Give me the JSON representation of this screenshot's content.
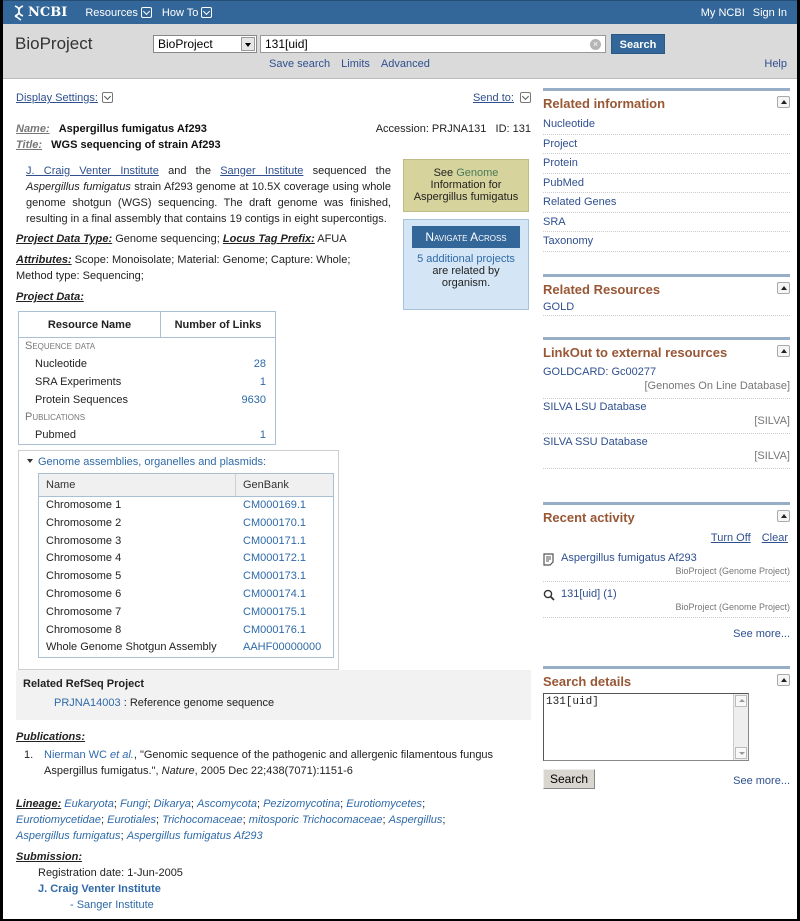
{
  "topbar": {
    "logo": "NCBI",
    "menus": [
      "Resources",
      "How To"
    ],
    "right_links": [
      "My NCBI",
      "Sign In"
    ]
  },
  "search": {
    "db_title": "BioProject",
    "db_selected": "BioProject",
    "term": "131[uid]",
    "button": "Search",
    "links": [
      "Save search",
      "Limits",
      "Advanced"
    ],
    "help": "Help"
  },
  "main": {
    "display_settings": "Display Settings:",
    "send_to": "Send to:",
    "name_label": "Name:",
    "name": "Aspergillus fumigatus Af293",
    "title_label": "Title:",
    "title": "WGS sequencing of strain Af293",
    "accession": "Accession: PRJNA131",
    "id": "ID: 131",
    "description": {
      "link1": "J. Craig Venter Institute",
      "t1": " and the ",
      "link2": "Sanger Institute",
      "t2": " sequenced the ",
      "species": "Aspergillus fumigatus",
      "t3": " strain Af293 genome at 10.5X coverage using whole genome shotgun (WGS) sequencing. The draft genome was finished, resulting in a final assembly that contains 19 contigs in eight supercontigs."
    },
    "genome_box": {
      "prefix": "See ",
      "link": "Genome",
      "line2": "Information for",
      "line3": "Aspergillus fumigatus"
    },
    "navigate_box": {
      "header": "Navigate Across",
      "link": "5 additional projects",
      "line2": "are related by",
      "line3": "organism."
    },
    "project_data_type_label": "Project Data Type:",
    "project_data_type": "Genome sequencing;",
    "locus_tag_label": "Locus Tag Prefix:",
    "locus_tag": "AFUA",
    "attributes_label": "Attributes:",
    "attributes": "Scope: Monoisolate; Material: Genome; Capture: Whole; Method type: Sequencing;",
    "project_data_label": "Project Data:",
    "project_table": {
      "headers": [
        "Resource Name",
        "Number of Links"
      ],
      "groups": [
        {
          "category": "Sequence data",
          "rows": [
            {
              "name": "Nucleotide",
              "value": "28"
            },
            {
              "name": "SRA Experiments",
              "value": "1"
            },
            {
              "name": "Protein Sequences",
              "value": "9630"
            }
          ]
        },
        {
          "category": "Publications",
          "rows": [
            {
              "name": "Pubmed",
              "value": "1"
            }
          ]
        }
      ]
    },
    "assemblies": {
      "title": "Genome assemblies, organelles and plasmids:",
      "headers": [
        "Name",
        "GenBank"
      ],
      "rows": [
        {
          "name": "Chromosome 1",
          "genbank": "CM000169.1"
        },
        {
          "name": "Chromosome 2",
          "genbank": "CM000170.1"
        },
        {
          "name": "Chromosome 3",
          "genbank": "CM000171.1"
        },
        {
          "name": "Chromosome 4",
          "genbank": "CM000172.1"
        },
        {
          "name": "Chromosome 5",
          "genbank": "CM000173.1"
        },
        {
          "name": "Chromosome 6",
          "genbank": "CM000174.1"
        },
        {
          "name": "Chromosome 7",
          "genbank": "CM000175.1"
        },
        {
          "name": "Chromosome 8",
          "genbank": "CM000176.1"
        },
        {
          "name": "Whole Genome Shotgun Assembly",
          "genbank": "AAHF00000000"
        }
      ]
    },
    "refseq": {
      "heading": "Related RefSeq Project",
      "link": "PRJNA14003",
      "desc": " : Reference genome sequence"
    },
    "publications": {
      "label": "Publications:",
      "items": [
        {
          "num": "1.",
          "authors": "Nierman WC",
          "etal": " et al.",
          "title": ", \"Genomic sequence of the pathogenic and allergenic filamentous fungus Aspergillus fumigatus.\", ",
          "journal": "Nature",
          "citation": ", 2005 Dec 22;438(7071):1151-6"
        }
      ]
    },
    "lineage": {
      "label": "Lineage:",
      "taxa": [
        "Eukaryota",
        "Fungi",
        "Dikarya",
        "Ascomycota",
        "Pezizomycotina",
        "Eurotiomycetes",
        "Eurotiomycetidae",
        "Eurotiales",
        "Trichocomaceae",
        "mitosporic Trichocomaceae",
        "Aspergillus",
        "Aspergillus fumigatus",
        "Aspergillus fumigatus Af293"
      ]
    },
    "submission": {
      "label": "Submission:",
      "registration": "Registration date: 1-Jun-2005",
      "institute": "J. Craig Venter Institute",
      "sub_institute": "- Sanger Institute"
    }
  },
  "sidebar": {
    "related_info": {
      "title": "Related information",
      "items": [
        "Nucleotide",
        "Project",
        "Protein",
        "PubMed",
        "Related Genes",
        "SRA",
        "Taxonomy"
      ]
    },
    "related_resources": {
      "title": "Related Resources",
      "items": [
        "GOLD"
      ]
    },
    "linkout": {
      "title": "LinkOut to external resources",
      "items": [
        {
          "title": "GOLDCARD: Gc00277",
          "source": "[Genomes On Line Database]"
        },
        {
          "title": "SILVA LSU Database",
          "source": "[SILVA]"
        },
        {
          "title": "SILVA SSU Database",
          "source": "[SILVA]"
        }
      ]
    },
    "recent_activity": {
      "title": "Recent activity",
      "turn_off": "Turn Off",
      "clear": "Clear",
      "items": [
        {
          "icon": "document-icon",
          "title": "Aspergillus fumigatus Af293",
          "source": "BioProject (Genome Project)"
        },
        {
          "icon": "search-icon",
          "title": "131[uid] (1)",
          "source": "BioProject (Genome Project)"
        }
      ],
      "see_more": "See more..."
    },
    "search_details": {
      "title": "Search details",
      "query": "131[uid]",
      "button": "Search",
      "see_more": "See more..."
    }
  }
}
